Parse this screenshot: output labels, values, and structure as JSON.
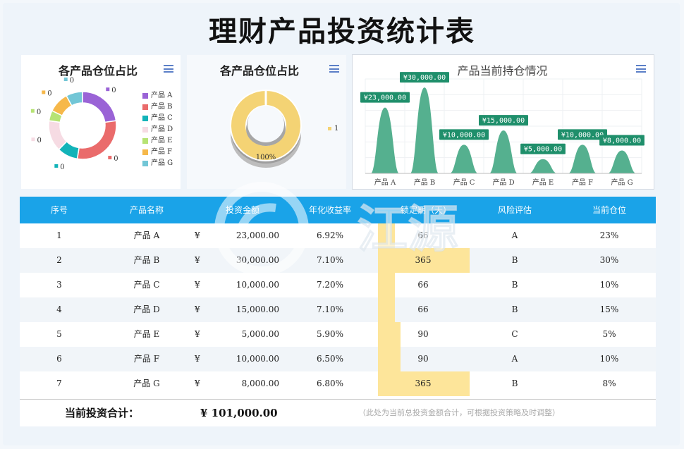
{
  "title": "理财产品投资统计表",
  "panel1": {
    "title": "各产品仓位占比",
    "legend": [
      {
        "label": "产品 A",
        "color": "#9a63d6"
      },
      {
        "label": "产品 B",
        "color": "#ea6b6b"
      },
      {
        "label": "产品 C",
        "color": "#12b3b8"
      },
      {
        "label": "产品 D",
        "color": "#f6dbe3"
      },
      {
        "label": "产品 E",
        "color": "#b6e374"
      },
      {
        "label": "产品 F",
        "color": "#f6b84a"
      },
      {
        "label": "产品 G",
        "color": "#72c6d6"
      }
    ],
    "labels": [
      "0",
      "0",
      "0",
      "0",
      "0",
      "0",
      "0"
    ]
  },
  "panel2": {
    "title": "各产品仓位占比",
    "slice_label": "100%",
    "legend_label": "1",
    "color": "#f4d374"
  },
  "panel3": {
    "title": "产品当前持仓情况",
    "color": "#55b08f"
  },
  "chart_data": [
    {
      "type": "pie",
      "title": "各产品仓位占比",
      "categories": [
        "产品 A",
        "产品 B",
        "产品 C",
        "产品 D",
        "产品 E",
        "产品 F",
        "产品 G"
      ],
      "values": [
        23,
        30,
        10,
        15,
        5,
        10,
        8
      ],
      "data_labels": [
        "0",
        "0",
        "0",
        "0",
        "0",
        "0",
        "0"
      ],
      "legend": "right"
    },
    {
      "type": "pie",
      "title": "各产品仓位占比",
      "categories": [
        "1"
      ],
      "values": [
        1
      ],
      "data_labels": [
        "100%"
      ],
      "legend": "right"
    },
    {
      "type": "area",
      "title": "产品当前持仓情况",
      "categories": [
        "产品 A",
        "产品 B",
        "产品 C",
        "产品 D",
        "产品 E",
        "产品 F",
        "产品 G"
      ],
      "values": [
        23000,
        30000,
        10000,
        15000,
        5000,
        10000,
        8000
      ],
      "data_labels": [
        "¥23,000.00",
        "¥30,000.00",
        "¥10,000.00",
        "¥15,000.00",
        "¥5,000.00",
        "¥10,000.00",
        "¥8,000.00"
      ],
      "grid": true
    }
  ],
  "table": {
    "headers": [
      "序号",
      "产品名称",
      "投资金额",
      "年化收益率",
      "锁定期（天）",
      "风险评估",
      "当前仓位"
    ],
    "rows": [
      {
        "no": "1",
        "name": "产品 A",
        "cur": "¥",
        "amount": "23,000.00",
        "rate": "6.92%",
        "lock": "66",
        "lock_days": 66,
        "risk": "A",
        "pos": "23%"
      },
      {
        "no": "2",
        "name": "产品 B",
        "cur": "¥",
        "amount": "30,000.00",
        "rate": "7.10%",
        "lock": "365",
        "lock_days": 365,
        "risk": "B",
        "pos": "30%"
      },
      {
        "no": "3",
        "name": "产品 C",
        "cur": "¥",
        "amount": "10,000.00",
        "rate": "7.20%",
        "lock": "66",
        "lock_days": 66,
        "risk": "B",
        "pos": "10%"
      },
      {
        "no": "4",
        "name": "产品 D",
        "cur": "¥",
        "amount": "15,000.00",
        "rate": "7.10%",
        "lock": "66",
        "lock_days": 66,
        "risk": "B",
        "pos": "15%"
      },
      {
        "no": "5",
        "name": "产品 E",
        "cur": "¥",
        "amount": "5,000.00",
        "rate": "5.90%",
        "lock": "90",
        "lock_days": 90,
        "risk": "C",
        "pos": "5%"
      },
      {
        "no": "6",
        "name": "产品 F",
        "cur": "¥",
        "amount": "10,000.00",
        "rate": "6.50%",
        "lock": "90",
        "lock_days": 90,
        "risk": "A",
        "pos": "10%"
      },
      {
        "no": "7",
        "name": "产品 G",
        "cur": "¥",
        "amount": "8,000.00",
        "rate": "6.80%",
        "lock": "365",
        "lock_days": 365,
        "risk": "B",
        "pos": "8%"
      }
    ]
  },
  "total": {
    "label": "当前投资合计：",
    "value": "¥  101,000.00",
    "note": "（此处为当前总投资金额合计，可根据投资策略及时调整）"
  },
  "watermark": {
    "text": "江源"
  }
}
